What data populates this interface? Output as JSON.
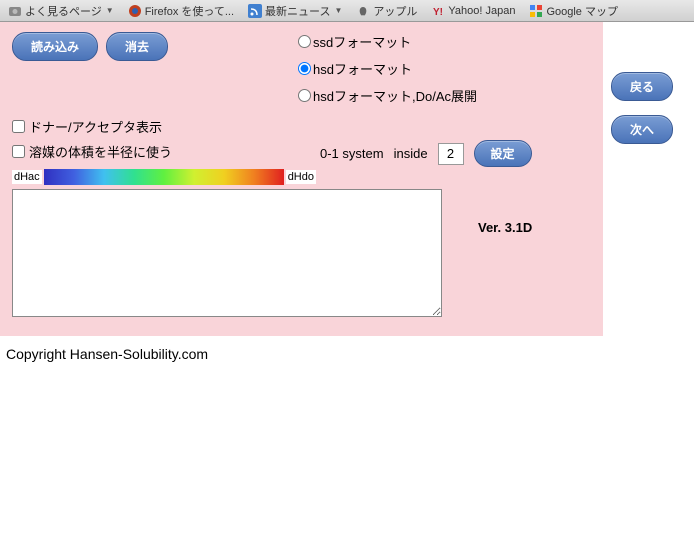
{
  "bookmarks": [
    {
      "label": "よく見るページ",
      "has_dropdown": true
    },
    {
      "label": "Firefox を使って...",
      "has_dropdown": false
    },
    {
      "label": "最新ニュース",
      "has_dropdown": true
    },
    {
      "label": "アップル",
      "has_dropdown": false
    },
    {
      "label": "Yahoo! Japan",
      "has_dropdown": false
    },
    {
      "label": "Google マップ",
      "has_dropdown": false
    }
  ],
  "buttons": {
    "load": "読み込み",
    "clear": "消去",
    "settings": "設定",
    "back": "戻る",
    "next": "次へ"
  },
  "format_options": {
    "ssd": "ssdフォーマット",
    "hsd": "hsdフォーマット",
    "hsd_doac": "hsdフォーマット,Do/Ac展開"
  },
  "checkboxes": {
    "donor_acceptor": "ドナー/アクセプタ表示",
    "solvent_volume": "溶媒の体積を半径に使う"
  },
  "settings_row": {
    "system_label": "0-1 system",
    "inside_label": "inside",
    "inside_value": "2"
  },
  "gradient": {
    "left_label": "dHac",
    "right_label": "dHdo"
  },
  "version": "Ver. 3.1D",
  "copyright": "Copyright Hansen-Solubility.com"
}
